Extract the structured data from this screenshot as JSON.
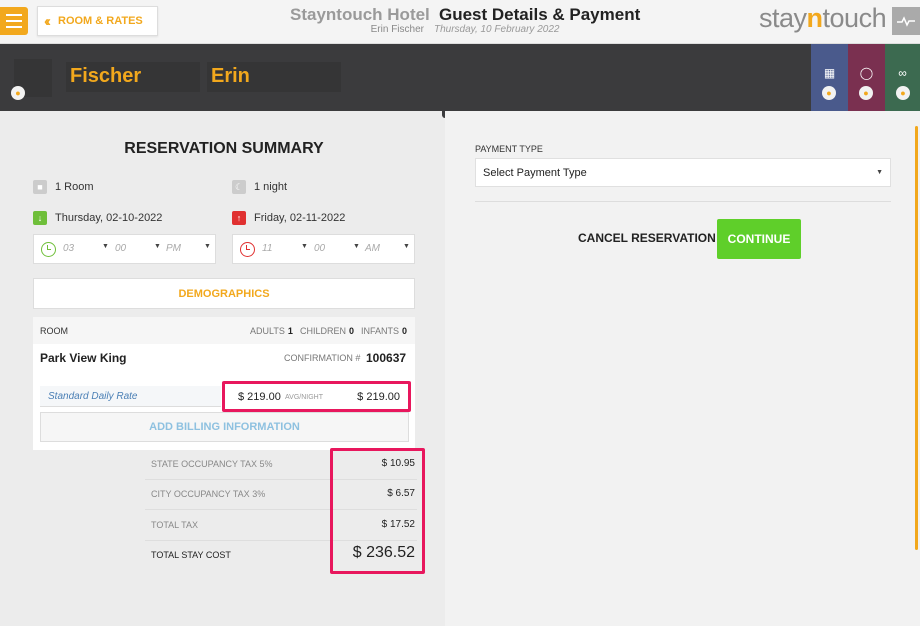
{
  "header": {
    "back_label": "ROOM & RATES",
    "hotel_name": "Stayntouch Hotel",
    "guest_name": "Erin Fischer",
    "page_title": "Guest Details & Payment",
    "business_date": "Thursday, 10 February 2022",
    "logo": {
      "pre": "stay",
      "mid": "n",
      "post": "touch"
    }
  },
  "guest": {
    "last_name": "Fischer",
    "first_name": "Erin"
  },
  "guest_cards": [
    {
      "name": "company-card",
      "color": "#4a5a8c",
      "icon": "building-icon"
    },
    {
      "name": "travel-agent-card",
      "color": "#7a3050",
      "icon": "globe-icon"
    },
    {
      "name": "group-card",
      "color": "#3c6a50",
      "icon": "circles-icon"
    }
  ],
  "summary": {
    "title": "RESERVATION SUMMARY",
    "rooms": "1 Room",
    "nights": "1 night",
    "arrival_date": "Thursday, 02-10-2022",
    "departure_date": "Friday, 02-11-2022",
    "arrival_time": {
      "hour": "03",
      "minute": "00",
      "ampm": "PM"
    },
    "departure_time": {
      "hour": "11",
      "minute": "00",
      "ampm": "AM"
    },
    "demographics_label": "DEMOGRAPHICS",
    "room_label": "ROOM",
    "adults_label": "ADULTS",
    "adults": "1",
    "children_label": "CHILDREN",
    "children": "0",
    "infants_label": "INFANTS",
    "infants": "0",
    "room_type": "Park View King",
    "confirmation_label": "CONFIRMATION #",
    "confirmation_number": "100637",
    "rate_name": "Standard Daily Rate",
    "avg_rate": "$ 219.00",
    "avg_night_label": "AVG/NIGHT",
    "rate_total": "$ 219.00",
    "billing_label": "ADD BILLING INFORMATION",
    "taxes": [
      {
        "label": "STATE OCCUPANCY TAX 5%",
        "value": "$ 10.95"
      },
      {
        "label": "CITY OCCUPANCY TAX 3%",
        "value": "$ 6.57"
      },
      {
        "label": "TOTAL TAX",
        "value": "$ 17.52"
      }
    ],
    "total_label": "TOTAL STAY COST",
    "total_value": "$ 236.52"
  },
  "payment": {
    "type_label": "PAYMENT TYPE",
    "type_selected": "Select Payment Type",
    "cancel_label": "CANCEL RESERVATION",
    "continue_label": "CONTINUE"
  },
  "colors": {
    "accent": "#f2a81d",
    "highlight": "#e8175d",
    "continue": "#5fcf2a",
    "link": "#4a7fb5"
  }
}
